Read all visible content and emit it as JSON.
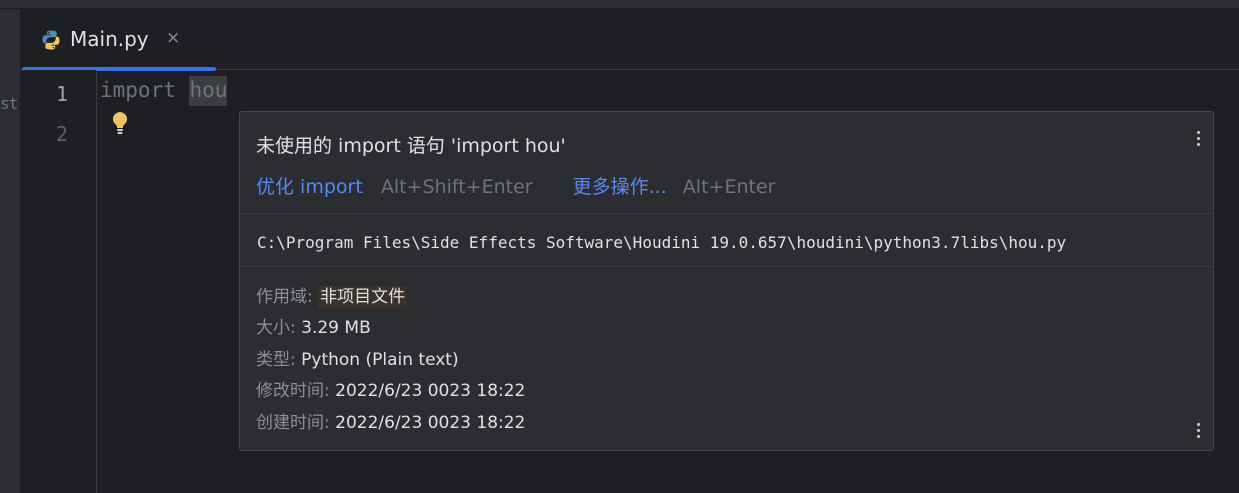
{
  "left_panel": {
    "peek_text": "st"
  },
  "tab": {
    "title": "Main.py",
    "close_glyph": "×",
    "icon": "python-icon"
  },
  "editor": {
    "line_numbers": [
      "1",
      "2"
    ],
    "code_keyword": "import",
    "code_module": "hou",
    "intention_icon": "lightbulb-icon"
  },
  "popup": {
    "title": "未使用的 import 语句 'import hou'",
    "primary_action": {
      "label": "优化 import",
      "shortcut": "Alt+Shift+Enter"
    },
    "more_action": {
      "label": "更多操作...",
      "shortcut": "Alt+Enter"
    },
    "path": "C:\\Program Files\\Side Effects Software\\Houdini 19.0.657\\houdini\\python3.7libs\\hou.py",
    "info": [
      {
        "key": "作用域:",
        "value": "非项目文件"
      },
      {
        "key": "大小:",
        "value": "3.29 MB"
      },
      {
        "key": "类型:",
        "value": "Python (Plain text)"
      },
      {
        "key": "修改时间:",
        "value": "2022/6/23 0023 18:22"
      },
      {
        "key": "创建时间:",
        "value": "2022/6/23 0023 18:22"
      }
    ]
  },
  "colors": {
    "background": "#1e1f22",
    "popup_bg": "#2b2d30",
    "link": "#548af7",
    "tab_underline": "#3574f0"
  }
}
